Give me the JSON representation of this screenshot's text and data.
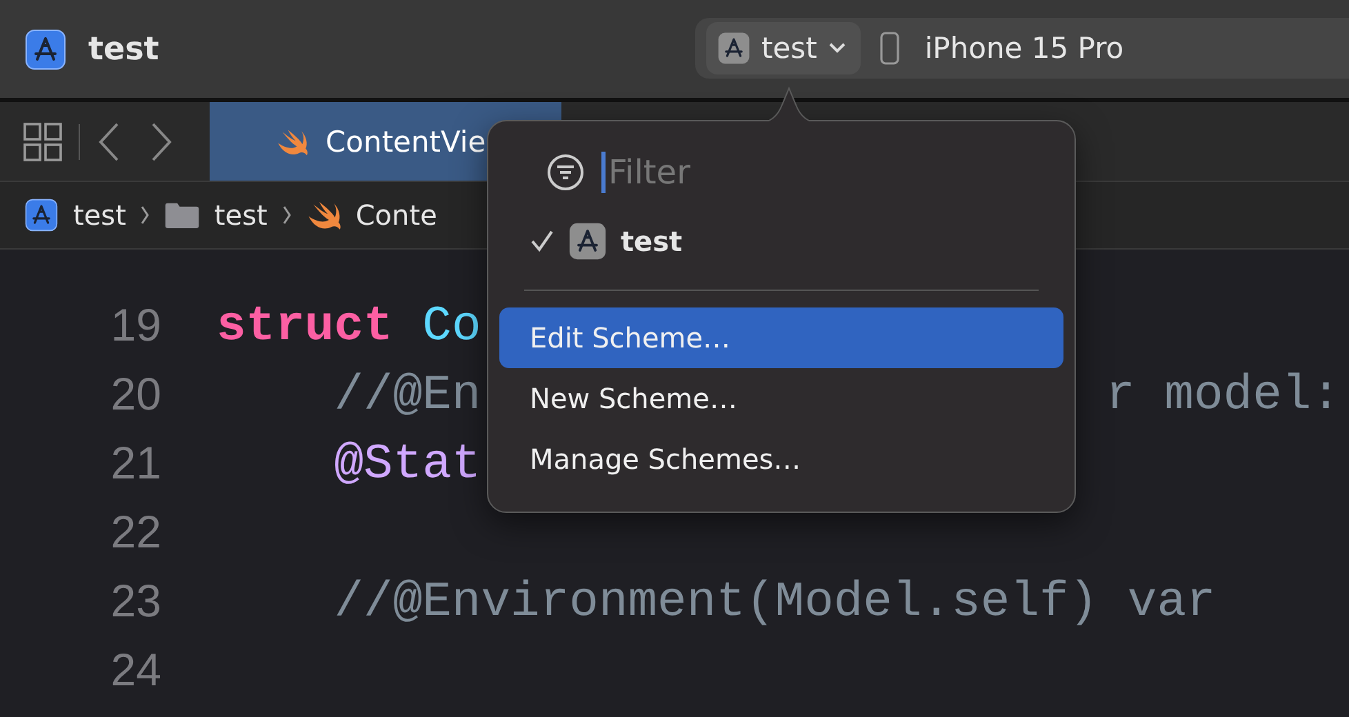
{
  "window": {
    "title": "test"
  },
  "scheme_selector": {
    "scheme": "test",
    "destination": "iPhone 15 Pro"
  },
  "tab": {
    "label": "ContentVie",
    "selected": true
  },
  "breadcrumbs": [
    {
      "kind": "project",
      "label": "test"
    },
    {
      "kind": "folder",
      "label": "test"
    },
    {
      "kind": "swift",
      "label": "Conte"
    }
  ],
  "editor": {
    "lines": [
      {
        "number": "19",
        "parts": [
          {
            "kind": "keyword",
            "text": "struct"
          },
          {
            "kind": "type",
            "text": "Co"
          }
        ]
      },
      {
        "number": "20",
        "parts": [
          {
            "kind": "comment",
            "text": "    //@En"
          }
        ],
        "right": {
          "kind": "comment",
          "text": "r model:"
        }
      },
      {
        "number": "21",
        "parts": [
          {
            "kind": "attribute",
            "text": "    @Stat"
          }
        ]
      },
      {
        "number": "22"
      },
      {
        "number": "23",
        "parts": [
          {
            "kind": "comment",
            "text": "    //@Environment(Model.self) var"
          }
        ]
      },
      {
        "number": "24"
      }
    ]
  },
  "scheme_menu": {
    "filter": {
      "placeholder": "Filter"
    },
    "schemes": [
      {
        "label": "test",
        "selected": true
      }
    ],
    "items": [
      {
        "label": "Edit Scheme…",
        "selected": true
      },
      {
        "label": "New Scheme…",
        "selected": false
      },
      {
        "label": "Manage Schemes…",
        "selected": false
      }
    ]
  }
}
